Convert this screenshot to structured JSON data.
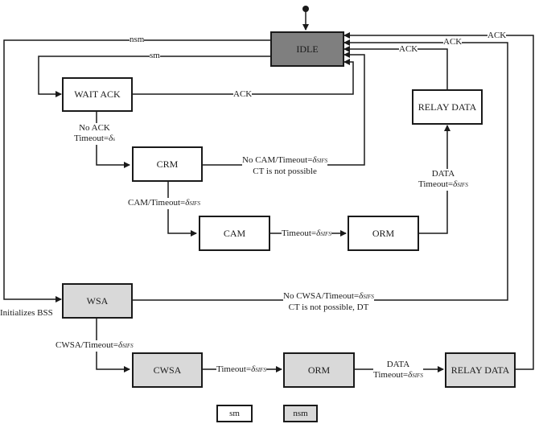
{
  "states": {
    "idle": "IDLE",
    "wait_ack": "WAIT ACK",
    "relay_data_top": "RELAY DATA",
    "crm": "CRM",
    "cam": "CAM",
    "orm_top": "ORM",
    "wsa": "WSA",
    "cwsa": "CWSA",
    "orm_bottom": "ORM",
    "relay_data_bottom": "RELAY DATA"
  },
  "transitions": {
    "nsm": "nsm",
    "sm": "sm",
    "ack_wait": "ACK",
    "ack_relay_top": "ACK",
    "ack_wsa": "ACK",
    "ack_relay_bottom": "ACK",
    "no_ack_line1": "No ACK",
    "no_ack_line2_prefix": "Timeout=",
    "no_ack_delta": "δ",
    "no_ack_sub": "s",
    "no_cam_line1_prefix": "No CAM/Timeout=",
    "no_cam_line2": "CT is not possible",
    "cam_timeout_prefix": "CAM/Timeout=",
    "timeout_prefix": "Timeout=",
    "data_line1": "DATA",
    "data_line2_prefix": "Timeout=",
    "no_cwsa_line1_prefix": "No CWSA/Timeout=",
    "no_cwsa_line2": "CT is not possible, DT",
    "cwsa_timeout_prefix": "CWSA/Timeout=",
    "initializes_bss": "Initializes BSS",
    "delta": "δ",
    "sifs": "SIFS"
  },
  "legend": {
    "sm": "sm",
    "nsm": "nsm"
  },
  "colors": {
    "idle_fill": "#7f7f7f",
    "nsm_fill": "#d9d9d9",
    "sm_fill": "#ffffff",
    "line": "#1a1a1a"
  }
}
